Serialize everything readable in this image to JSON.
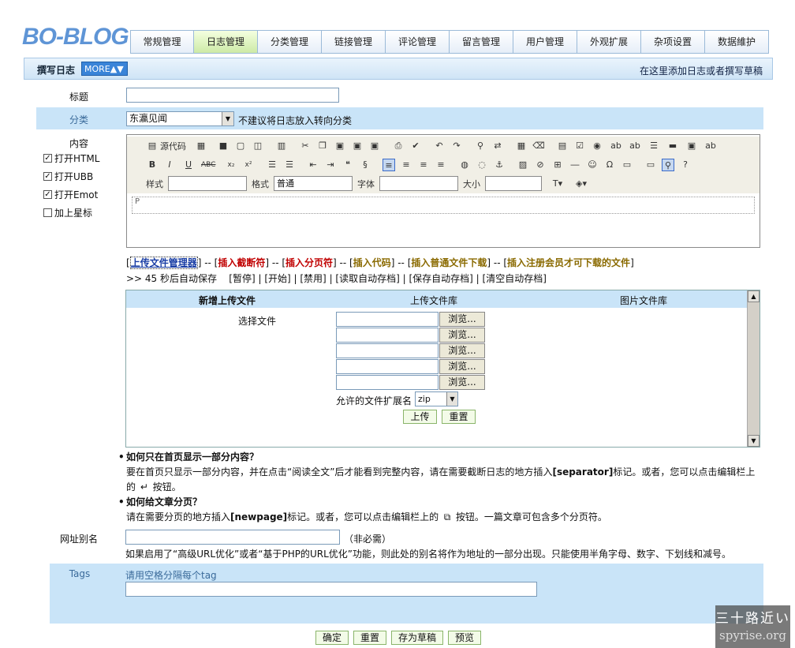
{
  "logo": "BO-BLOG",
  "nav": [
    "常规管理",
    "日志管理",
    "分类管理",
    "链接管理",
    "评论管理",
    "留言管理",
    "用户管理",
    "外观扩展",
    "杂项设置",
    "数据維护"
  ],
  "active_nav": "日志管理",
  "subbar": {
    "title": "撰写日志",
    "more": "MORE▲▼",
    "right_text": "在这里添加日志或者撰写草稿"
  },
  "fields": {
    "title_label": "标题",
    "category_label": "分类",
    "category_value": "东瀛见闻",
    "category_note": "不建议将日志放入转向分类",
    "content_label": "内容",
    "options": [
      {
        "label": "打开HTML",
        "checked": true
      },
      {
        "label": "打开UBB",
        "checked": true
      },
      {
        "label": "打开Emot",
        "checked": true
      },
      {
        "label": "加上星标",
        "checked": false
      }
    ]
  },
  "editor": {
    "source_label": "源代码",
    "style_label": "样式",
    "format_label": "格式",
    "format_value": "普通",
    "font_label": "字体",
    "size_label": "大小",
    "area_text": "P"
  },
  "insert_links": {
    "upload_manager": "上传文件管理器",
    "insert_break": "插入截断符",
    "insert_page": "插入分页符",
    "insert_code": "插入代码",
    "insert_download": "插入普通文件下载",
    "insert_member_download": "插入注册会员才可下载的文件"
  },
  "autosave": {
    "text": ">> 45 秒后自动保存",
    "items": [
      "[暂停]",
      "[开始]",
      "[禁用]",
      "[读取自动存档]",
      "[保存自动存档]",
      "[清空自动存档]"
    ]
  },
  "upload": {
    "tabs": [
      "新增上传文件",
      "上传文件库",
      "图片文件库"
    ],
    "choose_label": "选择文件",
    "browse_label": "浏览...",
    "ext_label": "允许的文件扩展名",
    "ext_value": "zip",
    "upload_btn": "上传",
    "reset_btn": "重置"
  },
  "help": {
    "q1": "如何只在首页显示一部分内容？",
    "a1_part1": "要在首页只显示一部分内容，并在点击“阅读全文”后才能看到完整内容，请在需要截断日志的地方插入",
    "a1_tag": "[separator]",
    "a1_part2": "标记。或者，您可以点击编辑栏上的",
    "a1_part3": "按钮。",
    "q2": "如何给文章分页？",
    "a2_part1": "请在需要分页的地方插入",
    "a2_tag": "[newpage]",
    "a2_part2": "标记。或者，您可以点击编辑栏上的",
    "a2_part3": "按钮。一篇文章可包含多个分页符。"
  },
  "url_alias": {
    "label": "网址别名",
    "optional": "（非必需）",
    "note": "如果启用了“高级URL优化”或者“基于PHP的URL优化”功能，则此处的别名将作为地址的一部分出现。只能使用半角字母、数字、下划线和减号。"
  },
  "tags": {
    "label": "Tags",
    "hint": "请用空格分隔每个tag"
  },
  "footer_buttons": [
    "确定",
    "重置",
    "存为草稿",
    "预览"
  ],
  "watermark": {
    "line1": "三十路近い",
    "line2": "spyrise.org"
  }
}
